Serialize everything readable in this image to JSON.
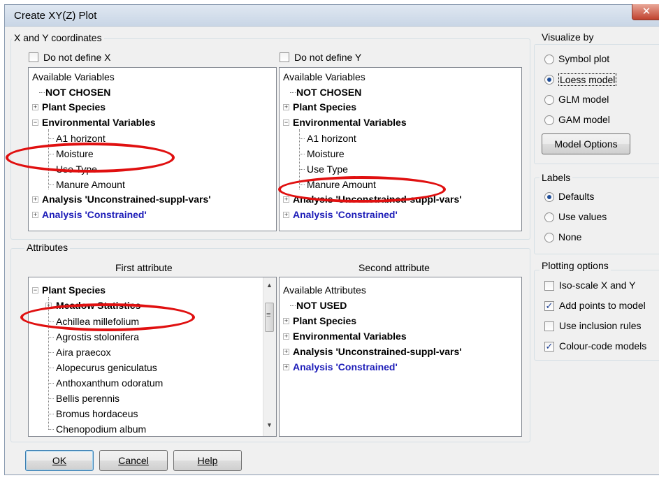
{
  "window": {
    "title": "Create XY(Z) Plot",
    "close_glyph": "✕"
  },
  "xy": {
    "group_label": "X and Y coordinates",
    "x": {
      "checkbox_label": "Do not define X",
      "tree": [
        "Available Variables",
        "NOT CHOSEN",
        "Plant Species",
        "Environmental Variables",
        "A1 horizont",
        "Moisture",
        "Use Type",
        "Manure Amount",
        "Analysis 'Unconstrained-suppl-vars'",
        "Analysis 'Constrained'"
      ]
    },
    "y": {
      "checkbox_label": "Do not define Y",
      "tree": [
        "Available Variables",
        "NOT CHOSEN",
        "Plant Species",
        "Environmental Variables",
        "A1 horizont",
        "Moisture",
        "Use Type",
        "Manure Amount",
        "Analysis 'Unconstrained-suppl-vars'",
        "Analysis 'Constrained'"
      ]
    }
  },
  "attributes": {
    "group_label": "Attributes",
    "first": {
      "header": "First attribute",
      "tree": [
        "Plant Species",
        "Meadow Statistics",
        "Achillea millefolium",
        "Agrostis stolonifera",
        "Aira praecox",
        "Alopecurus geniculatus",
        "Anthoxanthum odoratum",
        "Bellis perennis",
        "Bromus hordaceus",
        "Chenopodium album"
      ]
    },
    "second": {
      "header": "Second attribute",
      "tree": [
        "Available Attributes",
        "NOT USED",
        "Plant Species",
        "Environmental Variables",
        "Analysis 'Unconstrained-suppl-vars'",
        "Analysis 'Constrained'"
      ]
    }
  },
  "visualize": {
    "group_label": "Visualize by",
    "options": [
      "Symbol plot",
      "Loess model",
      "GLM model",
      "GAM model"
    ],
    "selected": "Loess model",
    "model_options_button": "Model Options"
  },
  "labels": {
    "group_label": "Labels",
    "options": [
      "Defaults",
      "Use values",
      "None"
    ],
    "selected": "Defaults"
  },
  "plotting": {
    "group_label": "Plotting options",
    "options": [
      {
        "label": "Iso-scale X and Y",
        "checked": false
      },
      {
        "label": "Add points to model",
        "checked": true
      },
      {
        "label": "Use inclusion rules",
        "checked": false
      },
      {
        "label": "Colour-code models",
        "checked": true
      }
    ],
    "check_glyph": "✓"
  },
  "buttons": {
    "ok": "OK",
    "cancel": "Cancel",
    "help": "Help"
  },
  "icons": {
    "plus": "+",
    "minus": "−",
    "scroll_up": "▲",
    "scroll_down": "▼",
    "grip": "≡"
  },
  "colors": {
    "highlight_ellipse": "#e01010",
    "link_blue": "#1c1cb8"
  }
}
